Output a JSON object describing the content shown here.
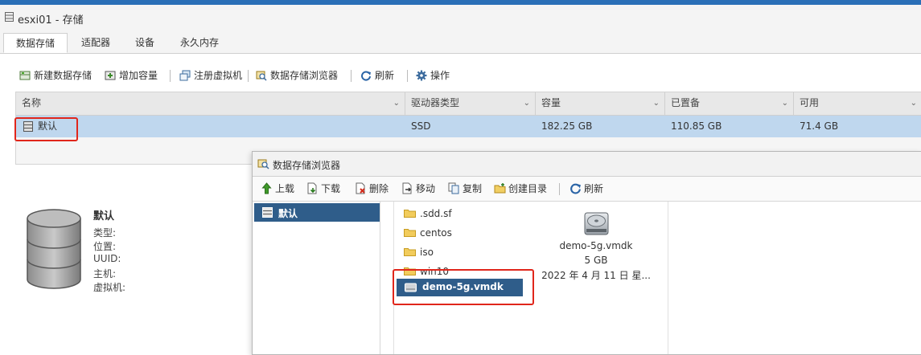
{
  "window": {
    "title": "esxi01 - 存储"
  },
  "tabs": [
    {
      "label": "数据存储",
      "active": true
    },
    {
      "label": "适配器"
    },
    {
      "label": "设备"
    },
    {
      "label": "永久内存"
    }
  ],
  "toolbar": {
    "new_datastore": "新建数据存储",
    "increase_capacity": "增加容量",
    "register_vm": "注册虚拟机",
    "datastore_browser": "数据存储浏览器",
    "refresh": "刷新",
    "actions": "操作"
  },
  "grid": {
    "columns": [
      "名称",
      "驱动器类型",
      "容量",
      "已置备",
      "可用"
    ],
    "rows": [
      {
        "name": "默认",
        "drive_type": "SSD",
        "capacity": "182.25 GB",
        "provisioned": "110.85 GB",
        "free": "71.4 GB"
      }
    ]
  },
  "details": {
    "name": "默认",
    "labels": [
      "类型:",
      "位置:",
      "UUID:",
      "主机:",
      "虚拟机:"
    ]
  },
  "browser": {
    "title": "数据存储浏览器",
    "toolbar": {
      "upload": "上载",
      "download": "下载",
      "delete": "删除",
      "move": "移动",
      "copy": "复制",
      "mkdir": "创建目录",
      "refresh": "刷新"
    },
    "datastores": [
      {
        "label": "默认"
      }
    ],
    "files": [
      ".sdd.sf",
      "centos",
      "iso",
      "win10"
    ],
    "selected_file": "demo-5g.vmdk",
    "preview": {
      "name": "demo-5g.vmdk",
      "size": "5 GB",
      "date": "2022 年 4 月 11 日 星..."
    }
  },
  "colors": {
    "accent": "#2a6fb7",
    "selected_row": "#bfd7ee",
    "selected_item": "#2f5d8a",
    "highlight_box": "#e0261b"
  }
}
